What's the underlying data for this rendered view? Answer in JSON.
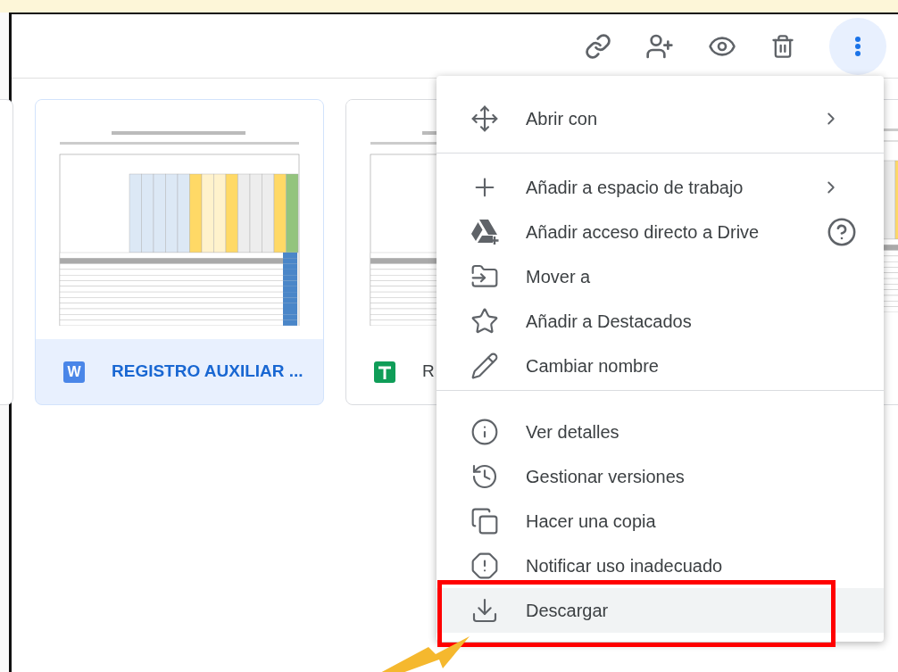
{
  "files": [
    {
      "name": "REGISTRO AUXILIAR ...",
      "kind": "word",
      "icon_letter": "W",
      "selected": true
    },
    {
      "name": "R",
      "kind": "sheets",
      "selected": false
    }
  ],
  "menu": {
    "sections": [
      [
        {
          "label": "Abrir con",
          "submenu": true,
          "help": false,
          "highlighted": false
        }
      ],
      [
        {
          "label": "Añadir a espacio de trabajo",
          "submenu": true,
          "help": false,
          "highlighted": false
        },
        {
          "label": "Añadir acceso directo a Drive",
          "submenu": false,
          "help": true,
          "highlighted": false
        },
        {
          "label": "Mover a",
          "submenu": false,
          "help": false,
          "highlighted": false
        },
        {
          "label": "Añadir a Destacados",
          "submenu": false,
          "help": false,
          "highlighted": false
        },
        {
          "label": "Cambiar nombre",
          "submenu": false,
          "help": false,
          "highlighted": false
        }
      ],
      [
        {
          "label": "Ver detalles",
          "submenu": false,
          "help": false,
          "highlighted": false
        },
        {
          "label": "Gestionar versiones",
          "submenu": false,
          "help": false,
          "highlighted": false
        },
        {
          "label": "Hacer una copia",
          "submenu": false,
          "help": false,
          "highlighted": false
        },
        {
          "label": "Notificar uso inadecuado",
          "submenu": false,
          "help": false,
          "highlighted": false
        },
        {
          "label": "Descargar",
          "submenu": false,
          "help": false,
          "highlighted": true
        }
      ]
    ]
  }
}
